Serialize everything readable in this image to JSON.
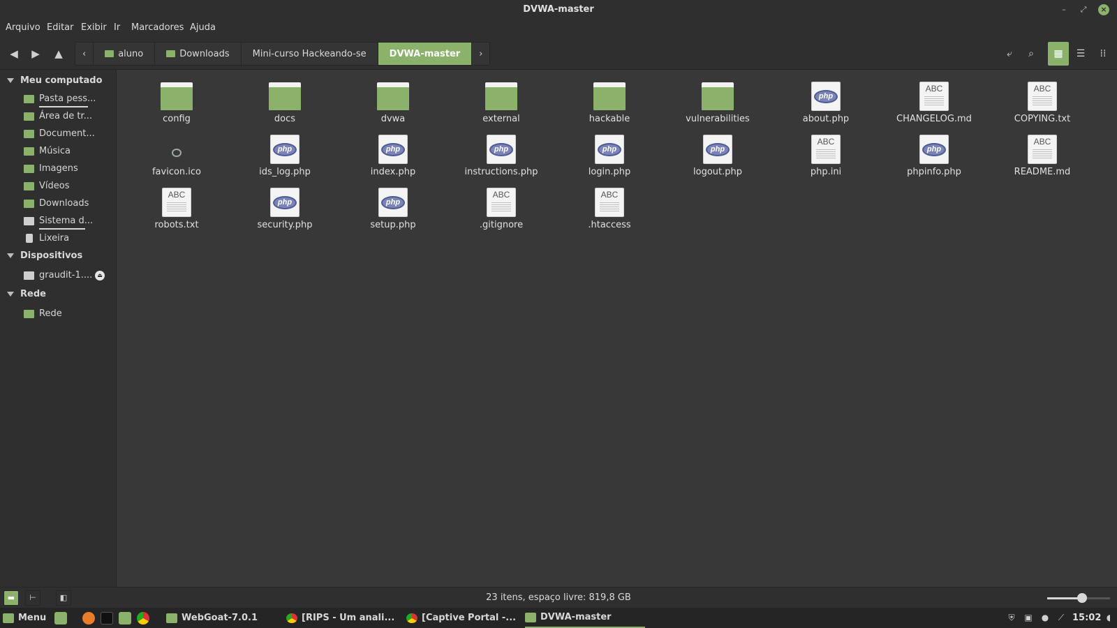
{
  "window": {
    "title": "DVWA-master"
  },
  "menubar": {
    "items": [
      "Arquivo",
      "Editar",
      "Exibir",
      "Ir",
      "Marcadores",
      "Ajuda"
    ]
  },
  "breadcrumb": {
    "items": [
      "aluno",
      "Downloads",
      "Mini-curso Hackeando-se",
      "DVWA-master"
    ],
    "active": "DVWA-master"
  },
  "sidebar": {
    "sections": [
      {
        "label": "Meu computado",
        "items": [
          "Pasta pess...",
          "Área de tr...",
          "Document...",
          "Música",
          "Imagens",
          "Vídeos",
          "Downloads",
          "Sistema d...",
          "Lixeira"
        ]
      },
      {
        "label": "Dispositivos",
        "items": [
          "graudit-1...."
        ]
      },
      {
        "label": "Rede",
        "items": [
          "Rede"
        ]
      }
    ]
  },
  "files": [
    {
      "name": "config",
      "type": "folder"
    },
    {
      "name": "docs",
      "type": "folder"
    },
    {
      "name": "dvwa",
      "type": "folder"
    },
    {
      "name": "external",
      "type": "folder"
    },
    {
      "name": "hackable",
      "type": "folder"
    },
    {
      "name": "vulnerabilities",
      "type": "folder"
    },
    {
      "name": "about.php",
      "type": "php"
    },
    {
      "name": "CHANGELOG.md",
      "type": "text"
    },
    {
      "name": "COPYING.txt",
      "type": "text"
    },
    {
      "name": "favicon.ico",
      "type": "image"
    },
    {
      "name": "ids_log.php",
      "type": "php"
    },
    {
      "name": "index.php",
      "type": "php"
    },
    {
      "name": "instructions.php",
      "type": "php"
    },
    {
      "name": "login.php",
      "type": "php"
    },
    {
      "name": "logout.php",
      "type": "php"
    },
    {
      "name": "php.ini",
      "type": "text"
    },
    {
      "name": "phpinfo.php",
      "type": "php"
    },
    {
      "name": "README.md",
      "type": "text"
    },
    {
      "name": "robots.txt",
      "type": "text"
    },
    {
      "name": "security.php",
      "type": "php"
    },
    {
      "name": "setup.php",
      "type": "php"
    },
    {
      "name": ".gitignore",
      "type": "text"
    },
    {
      "name": ".htaccess",
      "type": "text"
    }
  ],
  "icons": {
    "text_badge": "ABC",
    "php_badge": "php"
  },
  "status": {
    "text": "23 itens, espaço livre: 819,8 GB",
    "zoom_fraction": 0.55
  },
  "taskbar": {
    "menu_label": "Menu",
    "windows": [
      "WebGoat-7.0.1",
      "[RIPS - Um anali...",
      "[Captive Portal -...",
      "DVWA-master"
    ],
    "active": "DVWA-master",
    "clock": "15:02"
  },
  "colors": {
    "accent": "#8ab26b",
    "background": "#383838",
    "panel": "#2f2f2f"
  }
}
